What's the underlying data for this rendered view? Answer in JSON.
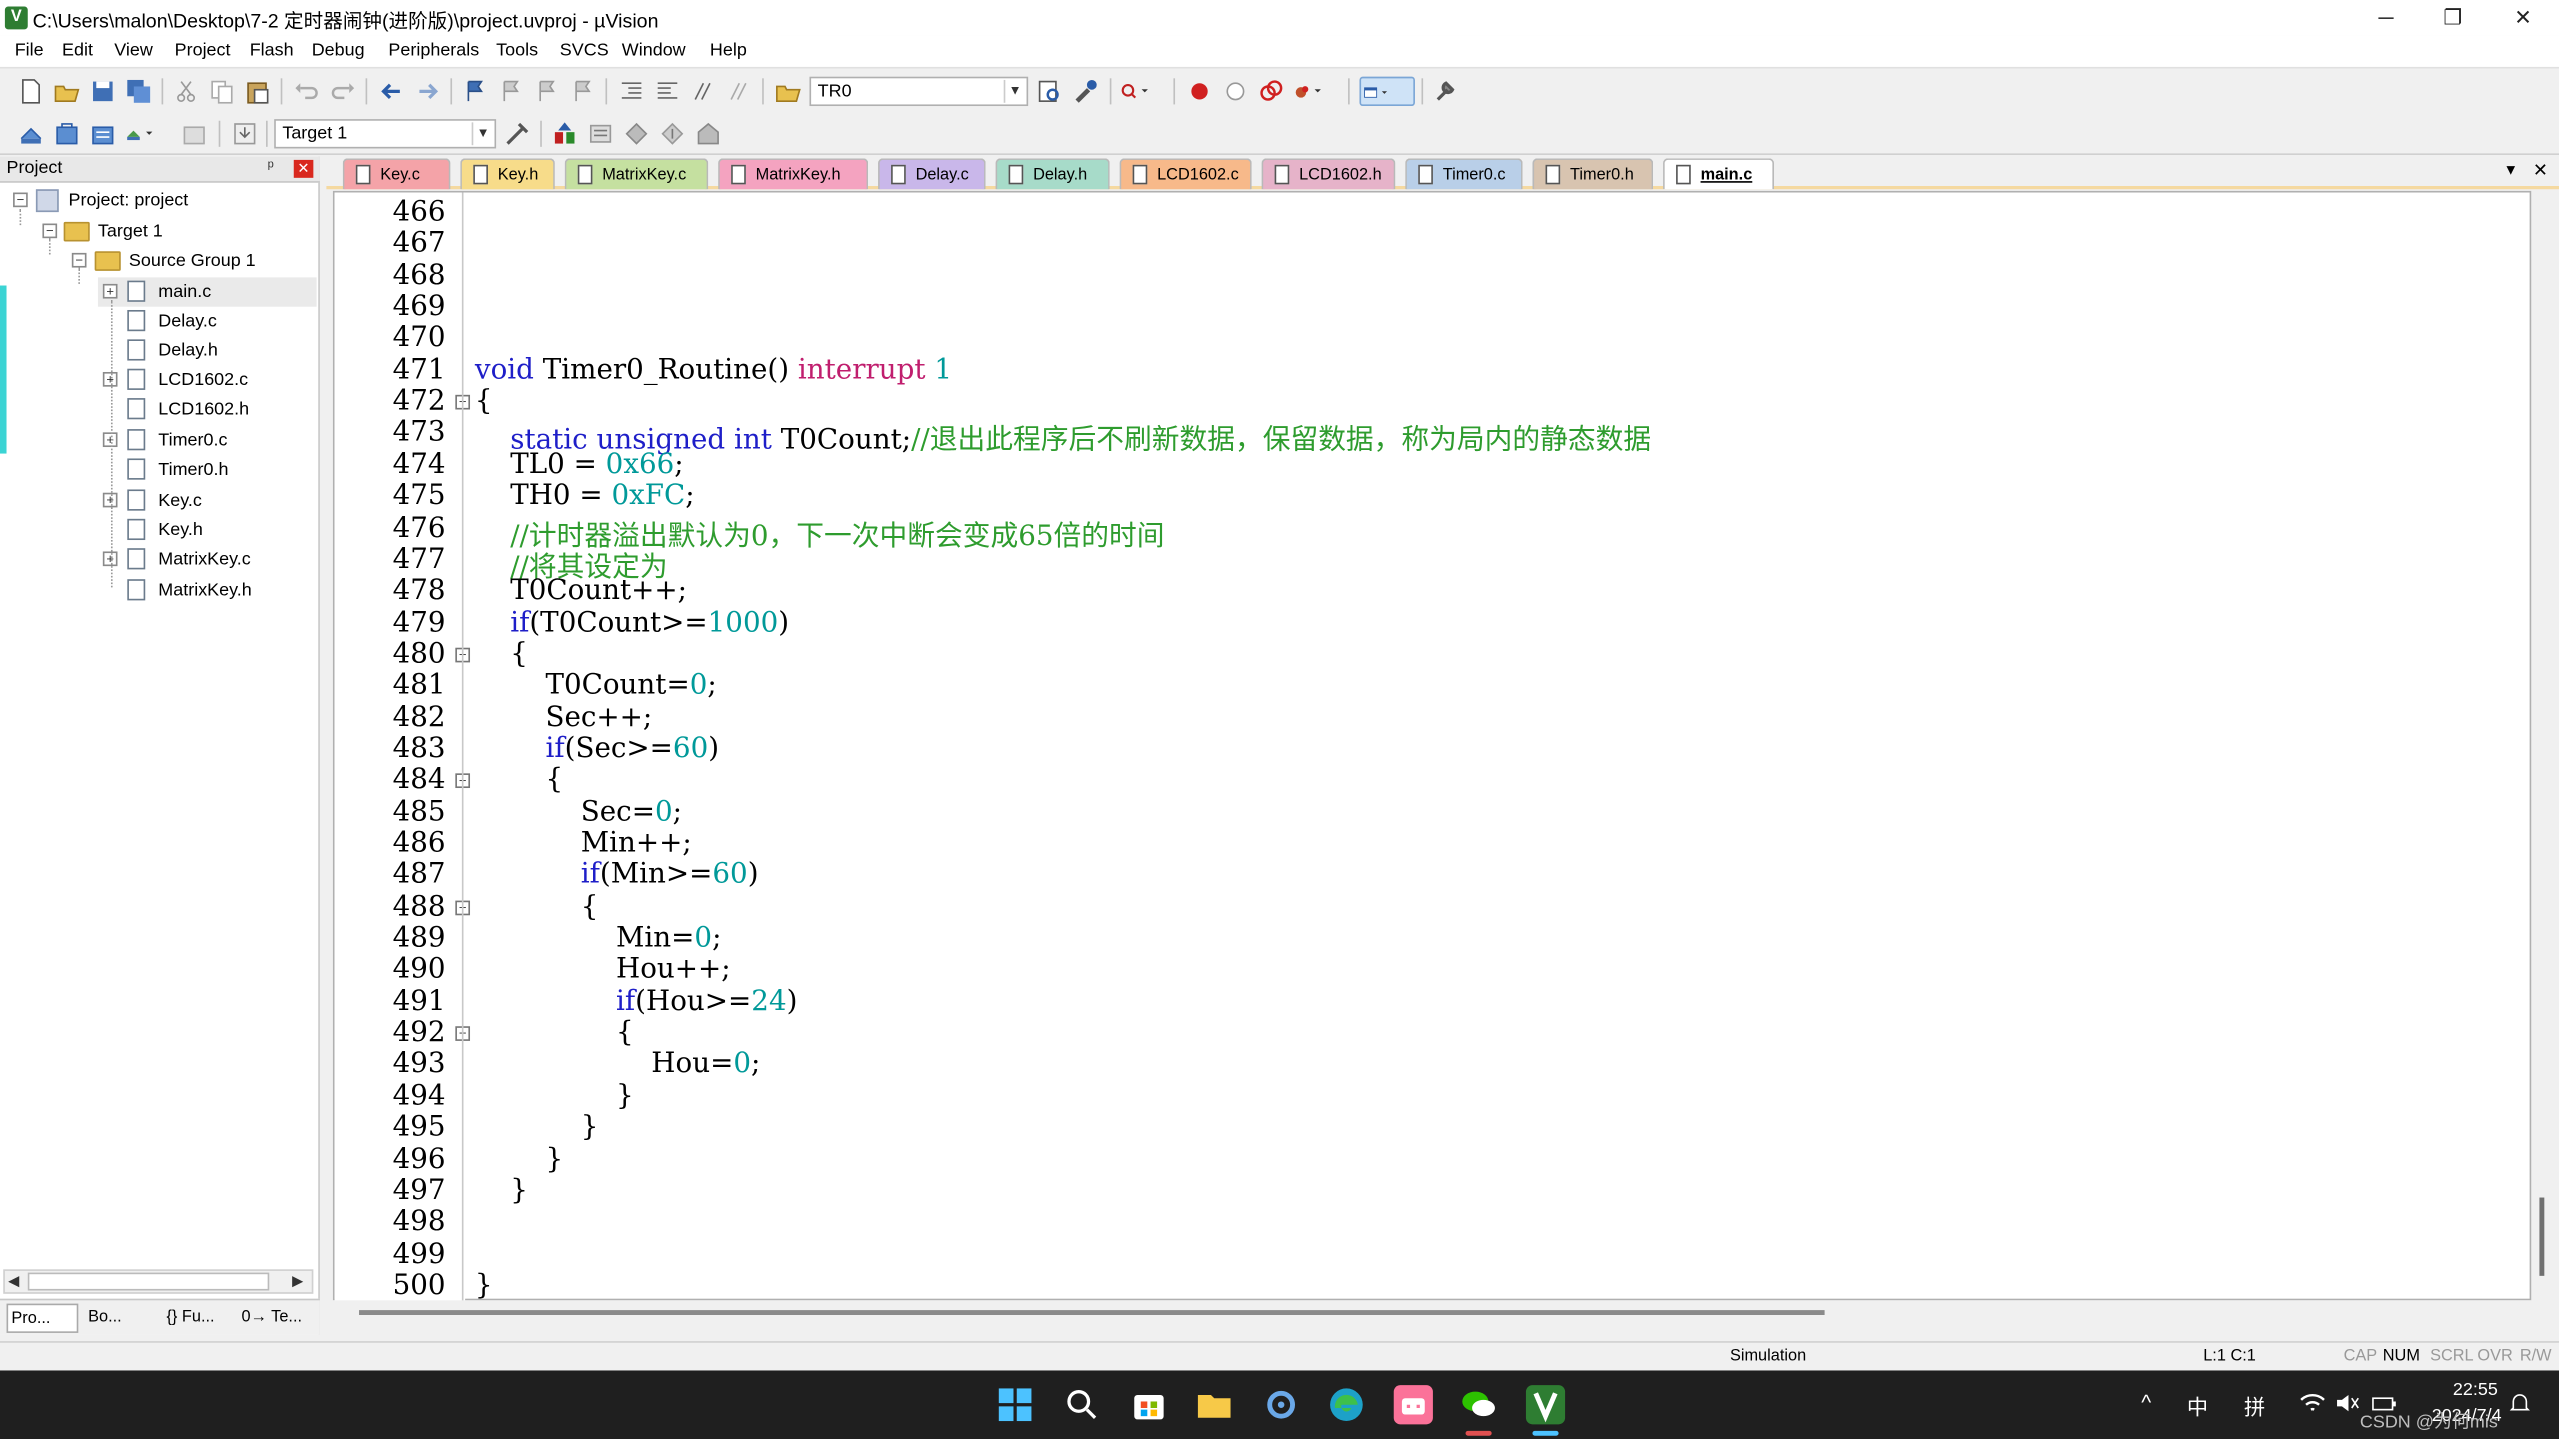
{
  "window": {
    "title": "C:\\Users\\malon\\Desktop\\7-2 定时器闹钟(进阶版)\\project.uvproj - µVision",
    "minimize": "─",
    "restore": "❐",
    "close": "✕"
  },
  "menu": [
    "File",
    "Edit",
    "View",
    "Project",
    "Flash",
    "Debug",
    "Peripherals",
    "Tools",
    "SVCS",
    "Window",
    "Help"
  ],
  "toolbar": {
    "find_combo": "TR0",
    "target_combo": "Target 1"
  },
  "project_panel": {
    "title": "Project",
    "pin": "ᵖ",
    "close": "✕",
    "tree": {
      "root": "Project: project",
      "target": "Target 1",
      "group": "Source Group 1",
      "files": [
        "main.c",
        "Delay.c",
        "Delay.h",
        "LCD1602.c",
        "LCD1602.h",
        "Timer0.c",
        "Timer0.h",
        "Key.c",
        "Key.h",
        "MatrixKey.c",
        "MatrixKey.h"
      ]
    },
    "bottom_tabs": [
      "Pro...",
      "Bo...",
      "{} Fu...",
      "0→ Te..."
    ]
  },
  "editor_tabs": [
    {
      "label": "Key.c",
      "color": "#f4a3a8"
    },
    {
      "label": "Key.h",
      "color": "#f7dc8a"
    },
    {
      "label": "MatrixKey.c",
      "color": "#c5e0a0"
    },
    {
      "label": "MatrixKey.h",
      "color": "#f4a3c0"
    },
    {
      "label": "Delay.c",
      "color": "#c9b7ea"
    },
    {
      "label": "Delay.h",
      "color": "#a7dbc9"
    },
    {
      "label": "LCD1602.c",
      "color": "#f7b98a"
    },
    {
      "label": "LCD1602.h",
      "color": "#e6b3c9"
    },
    {
      "label": "Timer0.c",
      "color": "#b9cfe8"
    },
    {
      "label": "Timer0.h",
      "color": "#d8c4b0"
    },
    {
      "label": "main.c",
      "color": "#ffffff"
    }
  ],
  "tabs_menu": "▼",
  "tabs_close": "✕",
  "code": {
    "line_numbers": [
      "466",
      "467",
      "468",
      "469",
      "470",
      "471",
      "472",
      "473",
      "474",
      "475",
      "476",
      "477",
      "478",
      "479",
      "480",
      "481",
      "482",
      "483",
      "484",
      "485",
      "486",
      "487",
      "488",
      "489",
      "490",
      "491",
      "492",
      "493",
      "494",
      "495",
      "496",
      "497",
      "498",
      "499",
      "500"
    ],
    "lines": [
      [],
      [],
      [],
      [],
      [],
      [
        [
          "kw",
          "void"
        ],
        [
          "",
          "·Timer0_Routine()·"
        ],
        [
          "it",
          "interrupt"
        ],
        [
          "",
          "·"
        ],
        [
          "num",
          "1"
        ]
      ],
      [
        [
          "",
          "{"
        ]
      ],
      [
        [
          "",
          "····"
        ],
        [
          "kw",
          "static"
        ],
        [
          "",
          "·"
        ],
        [
          "kw",
          "unsigned"
        ],
        [
          "",
          "·"
        ],
        [
          "kw",
          "int"
        ],
        [
          "",
          "·T0Count;"
        ],
        [
          "cm",
          "//退出此程序后不刷新数据，保留数据，称为局内的静态数据"
        ]
      ],
      [
        [
          "",
          "····TL0·=·"
        ],
        [
          "num",
          "0x66"
        ],
        [
          "",
          ";"
        ]
      ],
      [
        [
          "",
          "····TH0·=·"
        ],
        [
          "num",
          "0xFC"
        ],
        [
          "",
          ";"
        ]
      ],
      [
        [
          "",
          "····"
        ],
        [
          "cm",
          "//计时器溢出默认为0，下一次中断会变成65倍的时间"
        ]
      ],
      [
        [
          "",
          "····"
        ],
        [
          "cm",
          "//将其设定为"
        ]
      ],
      [
        [
          "",
          "····T0Count++;"
        ]
      ],
      [
        [
          "",
          "····"
        ],
        [
          "kw",
          "if"
        ],
        [
          "",
          "(T0Count>="
        ],
        [
          "num",
          "1000"
        ],
        [
          "",
          ")"
        ]
      ],
      [
        [
          "",
          "····{"
        ]
      ],
      [
        [
          "",
          "········T0Count="
        ],
        [
          "num",
          "0"
        ],
        [
          "",
          ";"
        ]
      ],
      [
        [
          "",
          "········Sec++;"
        ]
      ],
      [
        [
          "",
          "········"
        ],
        [
          "kw",
          "if"
        ],
        [
          "",
          "(Sec>="
        ],
        [
          "num",
          "60"
        ],
        [
          "",
          ")"
        ]
      ],
      [
        [
          "",
          "········{"
        ]
      ],
      [
        [
          "",
          "············Sec="
        ],
        [
          "num",
          "0"
        ],
        [
          "",
          ";"
        ]
      ],
      [
        [
          "",
          "············Min++;"
        ]
      ],
      [
        [
          "",
          "············"
        ],
        [
          "kw",
          "if"
        ],
        [
          "",
          "(Min>="
        ],
        [
          "num",
          "60"
        ],
        [
          "",
          ")"
        ]
      ],
      [
        [
          "",
          "············{"
        ]
      ],
      [
        [
          "",
          "················Min="
        ],
        [
          "num",
          "0"
        ],
        [
          "",
          ";"
        ]
      ],
      [
        [
          "",
          "················Hou++;"
        ]
      ],
      [
        [
          "",
          "················"
        ],
        [
          "kw",
          "if"
        ],
        [
          "",
          "(Hou>="
        ],
        [
          "num",
          "24"
        ],
        [
          "",
          ")"
        ]
      ],
      [
        [
          "",
          "················{"
        ]
      ],
      [
        [
          "",
          "····················Hou="
        ],
        [
          "num",
          "0"
        ],
        [
          "",
          ";"
        ]
      ],
      [
        [
          "",
          "················}"
        ]
      ],
      [
        [
          "",
          "············}"
        ]
      ],
      [
        [
          "",
          "········}"
        ]
      ],
      [
        [
          "",
          "····}"
        ]
      ],
      [],
      [],
      [
        [
          "",
          "}"
        ]
      ]
    ],
    "fold_lines": [
      "472",
      "480",
      "484",
      "488",
      "492"
    ]
  },
  "status": {
    "mode": "Simulation",
    "cursor": "L:1 C:1",
    "caps": "CAP",
    "num": "NUM",
    "scrl": "SCRL",
    "ovr": "OVR",
    "rw": "R/W"
  },
  "taskbar": {
    "tray_up": "^",
    "ime1": "中",
    "ime2": "拼",
    "time": "22:55",
    "date": "2024/7/4",
    "watermark": "CSDN @为何mis"
  }
}
